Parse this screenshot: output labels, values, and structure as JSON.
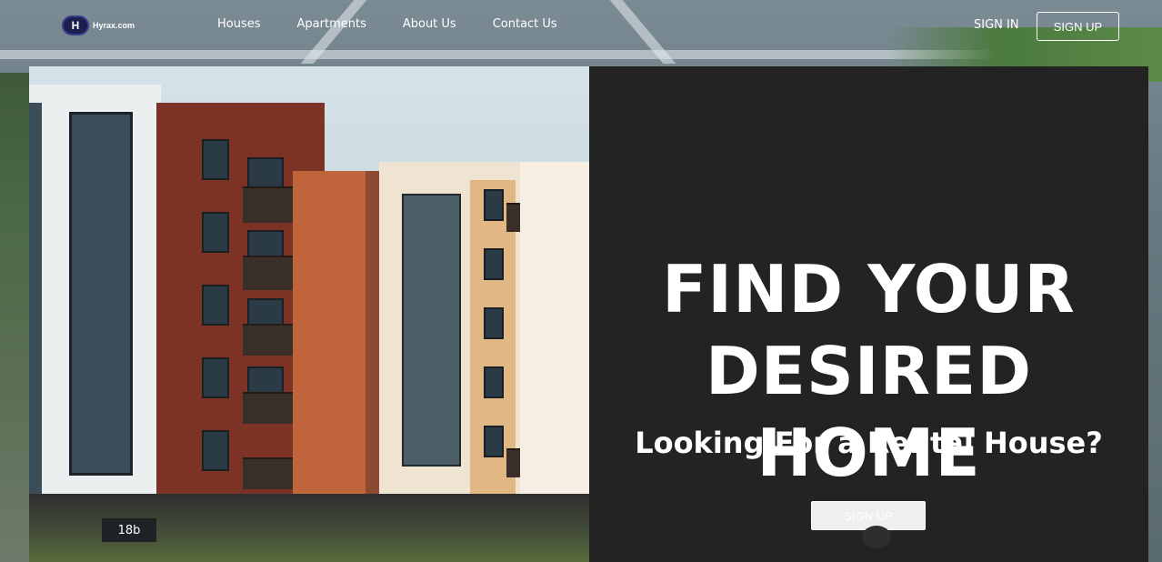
{
  "brand": {
    "logo_letter": "H",
    "logo_text": "Hyrax.com"
  },
  "nav": {
    "items": [
      {
        "label": "Houses"
      },
      {
        "label": "Apartments"
      },
      {
        "label": "About Us"
      },
      {
        "label": "Contact Us"
      }
    ]
  },
  "auth": {
    "signin_label": "SIGN IN",
    "signup_label": "SIGN UP"
  },
  "hero": {
    "headline_line1": "FIND YOUR",
    "headline_line2": "DESIRED HOME",
    "subheadline": "Looking For a Rental House?",
    "cta_label": "SIGN UP",
    "building_number": "18b"
  },
  "colors": {
    "panel": "#232323",
    "text": "#ffffff",
    "brick_red": "#8a3a2c",
    "brick_orange": "#c2643a"
  }
}
